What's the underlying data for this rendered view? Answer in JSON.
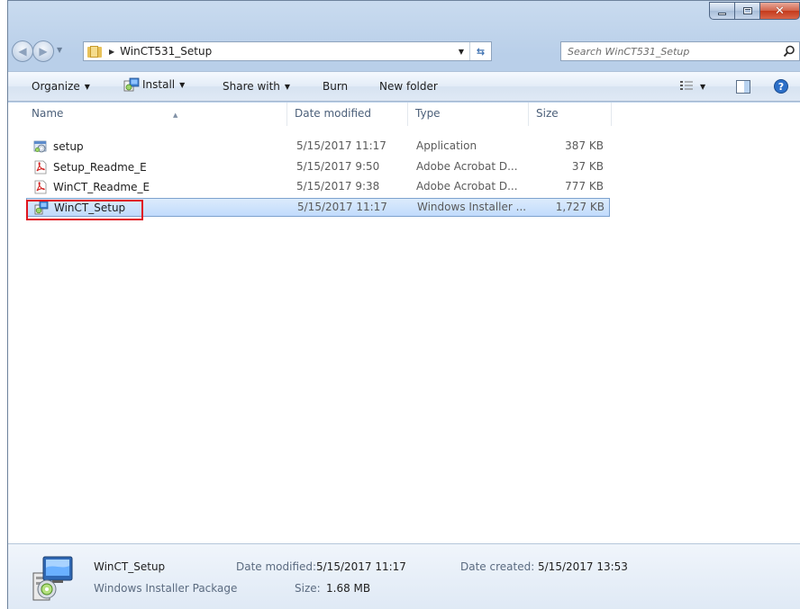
{
  "window": {
    "title": "WinCT531_Setup"
  },
  "address": {
    "crumb": "WinCT531_Setup",
    "search_placeholder": "Search WinCT531_Setup"
  },
  "toolbar": {
    "organize": "Organize",
    "install": "Install",
    "share_with": "Share with",
    "burn": "Burn",
    "new_folder": "New folder"
  },
  "columns": {
    "name": "Name",
    "date_modified": "Date modified",
    "type": "Type",
    "size": "Size"
  },
  "files": [
    {
      "name": "setup",
      "date": "5/15/2017 11:17",
      "type": "Application",
      "size": "387 KB",
      "icon": "application-icon"
    },
    {
      "name": "Setup_Readme_E",
      "date": "5/15/2017 9:50",
      "type": "Adobe Acrobat D...",
      "size": "37 KB",
      "icon": "pdf-icon"
    },
    {
      "name": "WinCT_Readme_E",
      "date": "5/15/2017 9:38",
      "type": "Adobe Acrobat D...",
      "size": "777 KB",
      "icon": "pdf-icon"
    },
    {
      "name": "WinCT_Setup",
      "date": "5/15/2017 11:17",
      "type": "Windows Installer ...",
      "size": "1,727 KB",
      "icon": "installer-icon",
      "selected": true
    }
  ],
  "details": {
    "name": "WinCT_Setup",
    "kind": "Windows Installer Package",
    "date_modified_label": "Date modified:",
    "date_modified": "5/15/2017 11:17",
    "size_label": "Size:",
    "size": "1.68 MB",
    "date_created_label": "Date created:",
    "date_created": "5/15/2017 13:53"
  },
  "colors": {
    "selection": "#c1dbfc",
    "highlight_box": "#e0141e",
    "close_button": "#c5391b"
  }
}
